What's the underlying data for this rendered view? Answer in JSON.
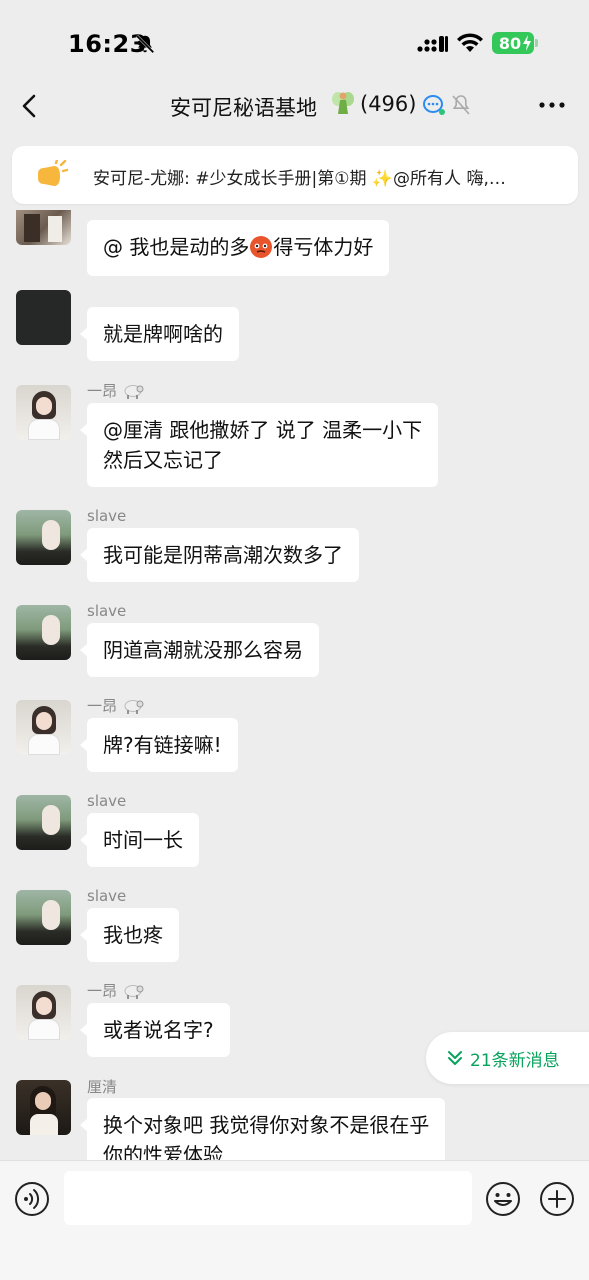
{
  "status_bar": {
    "time": "16:23",
    "battery": "80",
    "icons": [
      "bell-slash-icon",
      "signal-icon",
      "wifi-icon",
      "battery-charging-icon"
    ]
  },
  "nav": {
    "title": "安可尼秘语基地",
    "member_count": "(496)",
    "icons": [
      "back-icon",
      "fairy-icon",
      "chat-bubble-icon",
      "muted-icon",
      "more-icon"
    ]
  },
  "notice": {
    "text": "安可尼-尤娜: #少女成长手册|第①期 ✨@所有人 嗨,…"
  },
  "messages": [
    {
      "sender": "",
      "text_before": "@ 我也是动的多",
      "text_after": "得亏体力好",
      "emoji": "angry-face-emoji",
      "avatar": "photo-avatar-1"
    },
    {
      "sender": "",
      "text": "就是牌啊啥的",
      "avatar": "dark-avatar"
    },
    {
      "sender": "一昂",
      "sender_icon": "sheep-emoji",
      "text_lines": [
        "@厘清 跟他撒娇了 说了 温柔一小下",
        "然后又忘记了"
      ],
      "avatar": "girl-avatar"
    },
    {
      "sender": "slave",
      "text": "我可能是阴蒂高潮次数多了",
      "avatar": "outdoor-avatar"
    },
    {
      "sender": "slave",
      "text": "阴道高潮就没那么容易",
      "avatar": "outdoor-avatar"
    },
    {
      "sender": "一昂",
      "sender_icon": "sheep-emoji",
      "text": "牌?有链接嘛!",
      "avatar": "girl-avatar"
    },
    {
      "sender": "slave",
      "text": "时间一长",
      "avatar": "outdoor-avatar"
    },
    {
      "sender": "slave",
      "text": "我也疼",
      "avatar": "outdoor-avatar"
    },
    {
      "sender": "一昂",
      "sender_icon": "sheep-emoji",
      "text": "或者说名字?",
      "avatar": "girl-avatar"
    },
    {
      "sender": "厘清",
      "text_lines": [
        "换个对象吧 我觉得你对象不是很在乎",
        "你的性爱体验"
      ],
      "avatar": "photo-avatar-2"
    }
  ],
  "new_messages": {
    "label": "21条新消息"
  },
  "input_bar": {
    "placeholder": "",
    "icons": [
      "voice-icon",
      "emoji-icon",
      "plus-icon"
    ]
  },
  "colors": {
    "background": "#ededed",
    "bubble": "#ffffff",
    "accent_green": "#07a35c",
    "battery_green": "#34c759"
  }
}
